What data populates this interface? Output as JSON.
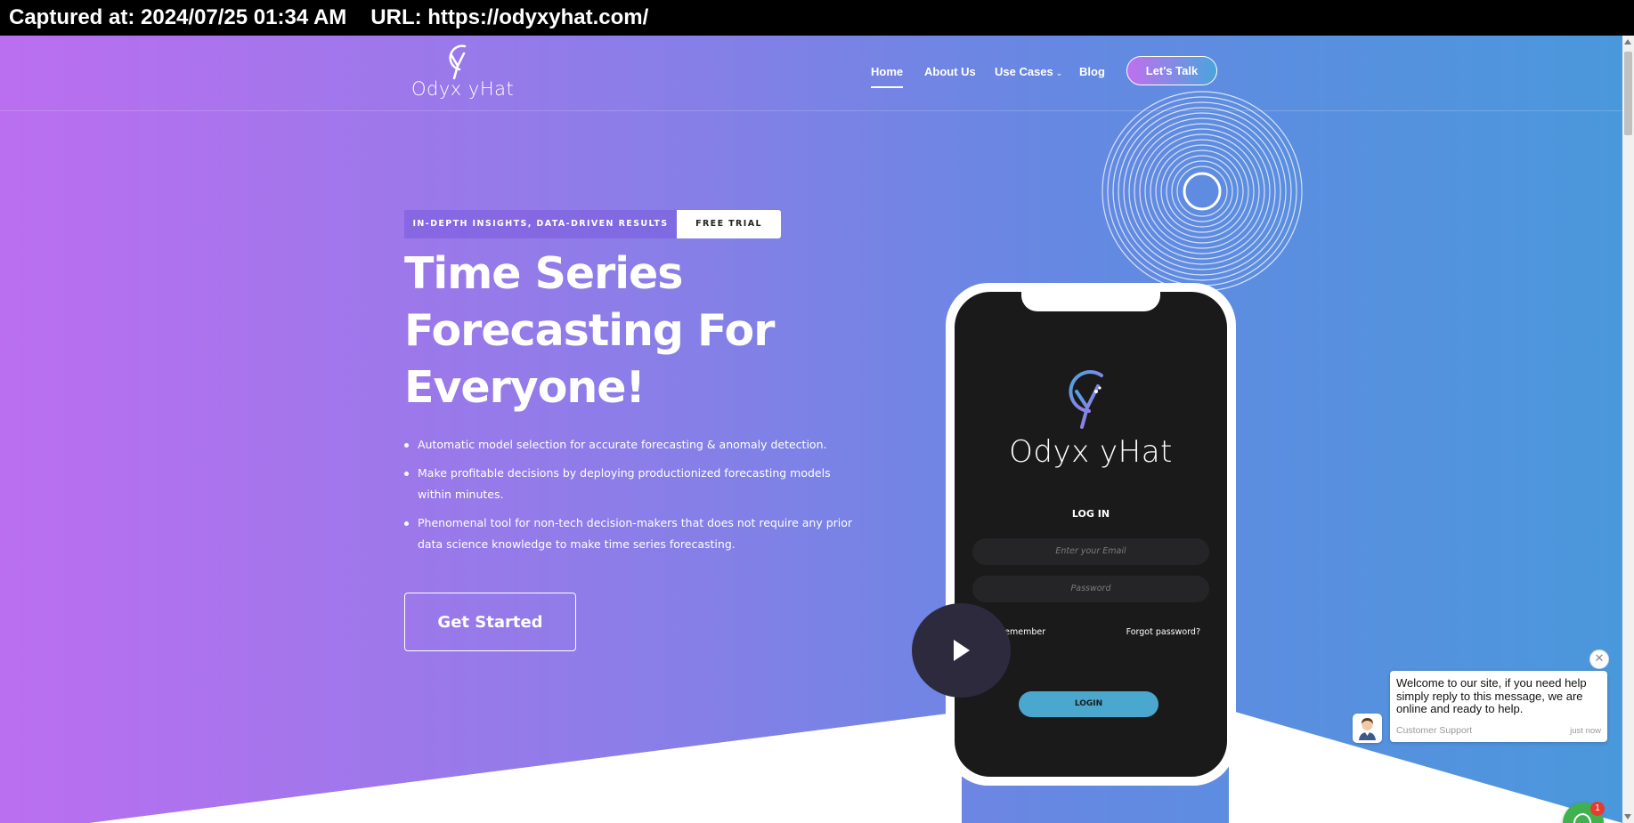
{
  "capture": {
    "captured_at": "Captured at: 2024/07/25 01:34 AM",
    "url": "URL: https://odyxyhat.com/"
  },
  "header": {
    "logo_text": "Odyx yHat",
    "nav": [
      {
        "label": "Home",
        "active": true
      },
      {
        "label": "About Us"
      },
      {
        "label": "Use Cases",
        "has_dropdown": true,
        "dropdown_icon": "chevron-down-icon"
      },
      {
        "label": "Blog"
      }
    ],
    "cta_label": "Let's Talk"
  },
  "hero": {
    "tag_text": "IN-DEPTH INSIGHTS, DATA-DRIVEN RESULTS",
    "tag_button": "FREE TRIAL",
    "title_lines": [
      "Time Series",
      "Forecasting For",
      "Everyone!"
    ],
    "bullets": [
      "Automatic model selection for accurate forecasting & anomaly detection.",
      "Make profitable decisions by deploying productionized forecasting models within minutes.",
      "Phenomenal tool for non-tech decision-makers that does not require any prior data science knowledge to make time series forecasting."
    ],
    "cta": "Get Started"
  },
  "phone": {
    "logo_text": "Odyx yHat",
    "login_heading": "LOG IN",
    "email_placeholder": "Enter your Email",
    "password_placeholder": "Password",
    "remember_label": "Remember",
    "forgot_label": "Forgot password?",
    "login_button": "LOGIN"
  },
  "video": {
    "icon": "play-icon"
  },
  "chat": {
    "message": "Welcome to our site, if you need help simply reply to this message, we are online and ready to help.",
    "sender": "Customer Support",
    "time": "just now",
    "unread_count": "1",
    "close_icon": "close-icon",
    "launcher_icon": "chat-icon"
  },
  "colors": {
    "gradient_start": "#bb6ef0",
    "gradient_end": "#4a98dc",
    "login_button": "#4aa8cf",
    "chat_launcher": "#3fb24f",
    "badge": "#e63b2e"
  }
}
